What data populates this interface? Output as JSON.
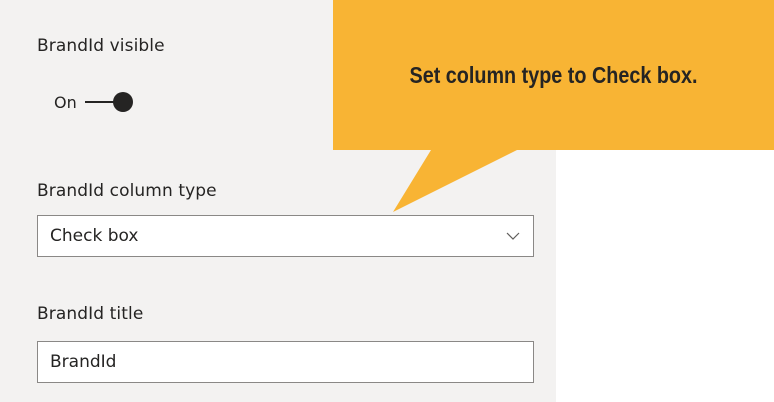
{
  "visible_section": {
    "label": "BrandId visible",
    "toggle_state": "On",
    "toggle_on": true
  },
  "column_type_section": {
    "label": "BrandId column type",
    "selected_value": "Check box",
    "chevron_icon": "chevron-down-icon"
  },
  "title_section": {
    "label": "BrandId title",
    "value": "BrandId"
  },
  "callout": {
    "text": "Set column type to Check box.",
    "color": "#f8b434"
  },
  "colors": {
    "panel_background": "#f3f2f1",
    "text": "#252423",
    "input_border": "#8a8886"
  }
}
